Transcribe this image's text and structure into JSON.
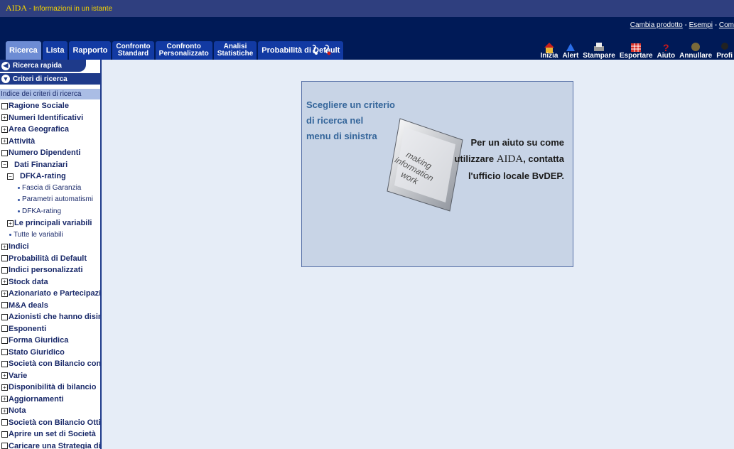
{
  "window": {
    "app_name": "AIDA",
    "app_subtitle": " - Informazioni in un istante"
  },
  "top_links": {
    "cambia": "Cambia prodotto",
    "sep": " - ",
    "esempi": "Esempi",
    "sep2": " - ",
    "com": "Com"
  },
  "tabs": [
    {
      "label": "Ricerca"
    },
    {
      "label": "Lista"
    },
    {
      "label": "Rapporto"
    },
    {
      "label": "Confronto\nStandard"
    },
    {
      "label": "Confronto\nPersonalizzato"
    },
    {
      "label": "Analisi\nStatistiche"
    },
    {
      "label": "Probabilità di Default"
    }
  ],
  "toolbar": [
    {
      "label": "Inizia",
      "icon": "house-icon"
    },
    {
      "label": "Alert",
      "icon": "bell-icon"
    },
    {
      "label": "Stampare",
      "icon": "printer-icon"
    },
    {
      "label": "Esportare",
      "icon": "table-export-icon"
    },
    {
      "label": "Aiuto",
      "icon": "question-icon"
    },
    {
      "label": "Annullare",
      "icon": "undo-icon"
    },
    {
      "label": "Profi",
      "icon": "profile-icon"
    }
  ],
  "sidebar": {
    "quick_search": "Ricerca rapida",
    "criteria": "Criteri di ricerca",
    "index_header": "Indice dei criteri di ricerca",
    "items": [
      {
        "label": "Ragione Sociale"
      },
      {
        "label": "Numeri Identificativi"
      },
      {
        "label": "Area Geografica"
      },
      {
        "label": "Attività"
      },
      {
        "label": "Numero Dipendenti"
      },
      {
        "label": "Dati Finanziari"
      },
      {
        "label": "DFKA-rating"
      },
      {
        "label": "Fascia di Garanzia"
      },
      {
        "label": "Parametri automatismi"
      },
      {
        "label": "DFKA-rating"
      },
      {
        "label": "Le principali variabili"
      },
      {
        "label": "Tutte le variabili"
      },
      {
        "label": "Indici"
      },
      {
        "label": "Probabilità di Default"
      },
      {
        "label": "Indici personalizzati"
      },
      {
        "label": "Stock data"
      },
      {
        "label": "Azionariato e Partecipazioni"
      },
      {
        "label": "M&A deals"
      },
      {
        "label": "Azionisti che hanno disinvestito"
      },
      {
        "label": "Esponenti"
      },
      {
        "label": "Forma Giuridica"
      },
      {
        "label": "Stato Giuridico"
      },
      {
        "label": "Società con Bilancio consolidato"
      },
      {
        "label": "Varie"
      },
      {
        "label": "Disponibilità di bilancio"
      },
      {
        "label": "Aggiornamenti"
      },
      {
        "label": "Nota"
      },
      {
        "label": "Società con Bilancio Ottico"
      },
      {
        "label": "Aprire un set di Società"
      },
      {
        "label": "Caricare una Strategia di ricerca"
      }
    ]
  },
  "banner": {
    "left": "Scegliere un criterio\ndi ricerca nel\nmenu di sinistra",
    "key_text": "making\ninformation\nwork",
    "right_line1": "Per un aiuto su come",
    "right_line2_pre": "utilizzare ",
    "right_line2_brand": "AIDA",
    "right_line2_post": ", contatta",
    "right_line3": "l'ufficio locale BvDEP."
  }
}
